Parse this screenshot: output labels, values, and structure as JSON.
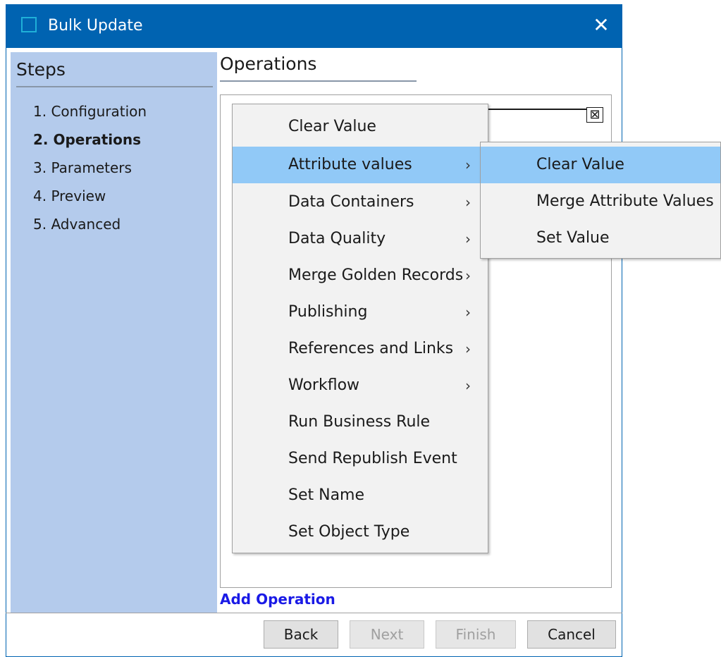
{
  "window": {
    "title": "Bulk Update",
    "close_glyph": "✕",
    "colors": {
      "titlebar": "#0063b1",
      "steps_panel": "#b4cbec",
      "menu_highlight": "#91c9f7",
      "link": "#1a1ae6"
    }
  },
  "steps": {
    "heading": "Steps",
    "items": [
      {
        "label": "1. Configuration",
        "active": false
      },
      {
        "label": "2. Operations",
        "active": true
      },
      {
        "label": "3. Parameters",
        "active": false
      },
      {
        "label": "4. Preview",
        "active": false
      },
      {
        "label": "5. Advanced",
        "active": false
      }
    ]
  },
  "operations": {
    "heading": "Operations",
    "add_operation_label": "Add Operation",
    "field_button_icon": "close-box-icon"
  },
  "context_menu": {
    "items": [
      {
        "label": "Clear Value",
        "submenu": false,
        "highlighted": false
      },
      {
        "label": "Attribute values",
        "submenu": true,
        "highlighted": true
      },
      {
        "label": "Data Containers",
        "submenu": true,
        "highlighted": false
      },
      {
        "label": "Data Quality",
        "submenu": true,
        "highlighted": false
      },
      {
        "label": "Merge Golden Records",
        "submenu": true,
        "highlighted": false
      },
      {
        "label": "Publishing",
        "submenu": true,
        "highlighted": false
      },
      {
        "label": "References and Links",
        "submenu": true,
        "highlighted": false
      },
      {
        "label": "Workflow",
        "submenu": true,
        "highlighted": false
      },
      {
        "label": "Run Business Rule",
        "submenu": false,
        "highlighted": false
      },
      {
        "label": "Send Republish Event",
        "submenu": false,
        "highlighted": false
      },
      {
        "label": "Set Name",
        "submenu": false,
        "highlighted": false
      },
      {
        "label": "Set Object Type",
        "submenu": false,
        "highlighted": false
      }
    ],
    "chevron_glyph": "›"
  },
  "submenu": {
    "items": [
      {
        "label": "Clear Value",
        "highlighted": true
      },
      {
        "label": "Merge Attribute Values",
        "highlighted": false
      },
      {
        "label": "Set Value",
        "highlighted": false
      }
    ]
  },
  "footer": {
    "back_label": "Back",
    "next_label": "Next",
    "finish_label": "Finish",
    "cancel_label": "Cancel"
  }
}
